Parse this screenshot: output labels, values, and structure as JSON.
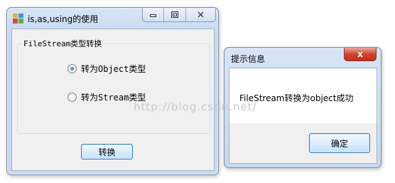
{
  "main_window": {
    "title": "is,as,using的使用",
    "caption_buttons": {
      "minimize_icon": "minimize-icon",
      "maximize_icon": "maximize-icon",
      "close_icon": "close-icon"
    },
    "groupbox": {
      "legend": "FileStream类型转换",
      "radios": [
        {
          "label": "转为Object类型",
          "checked": true
        },
        {
          "label": "转为Stream类型",
          "checked": false
        }
      ]
    },
    "convert_button": "转换"
  },
  "message_box": {
    "title": "提示信息",
    "close_glyph": "x",
    "message": "FileStream转换为object成功",
    "ok_button": "确定"
  },
  "watermark": "http://blog.csdn.net/"
}
